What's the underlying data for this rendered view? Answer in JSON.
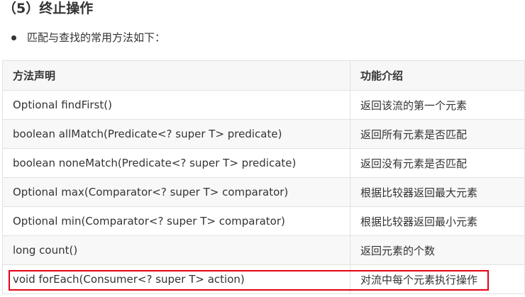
{
  "section": {
    "heading": "（5）终止操作",
    "bullet": "匹配与查找的常用方法如下："
  },
  "table": {
    "headers": [
      "方法声明",
      "功能介绍"
    ],
    "rows": [
      {
        "method": "Optional findFirst()",
        "desc": "返回该流的第一个元素"
      },
      {
        "method": "boolean allMatch(Predicate<? super T> predicate)",
        "desc": "返回所有元素是否匹配"
      },
      {
        "method": "boolean noneMatch(Predicate<? super T> predicate)",
        "desc": "返回没有元素是否匹配"
      },
      {
        "method": "Optional max(Comparator<? super T> comparator)",
        "desc": "根据比较器返回最大元素"
      },
      {
        "method": "Optional min(Comparator<? super T> comparator)",
        "desc": "根据比较器返回最小元素"
      },
      {
        "method": "long count()",
        "desc": "返回元素的个数"
      },
      {
        "method": "void forEach(Consumer<? super T> action)",
        "desc": "对流中每个元素执行操作"
      }
    ]
  },
  "colors": {
    "highlight_border": "#e60012",
    "header_bg": "#f7f7f7",
    "border": "#dfe2e5"
  }
}
